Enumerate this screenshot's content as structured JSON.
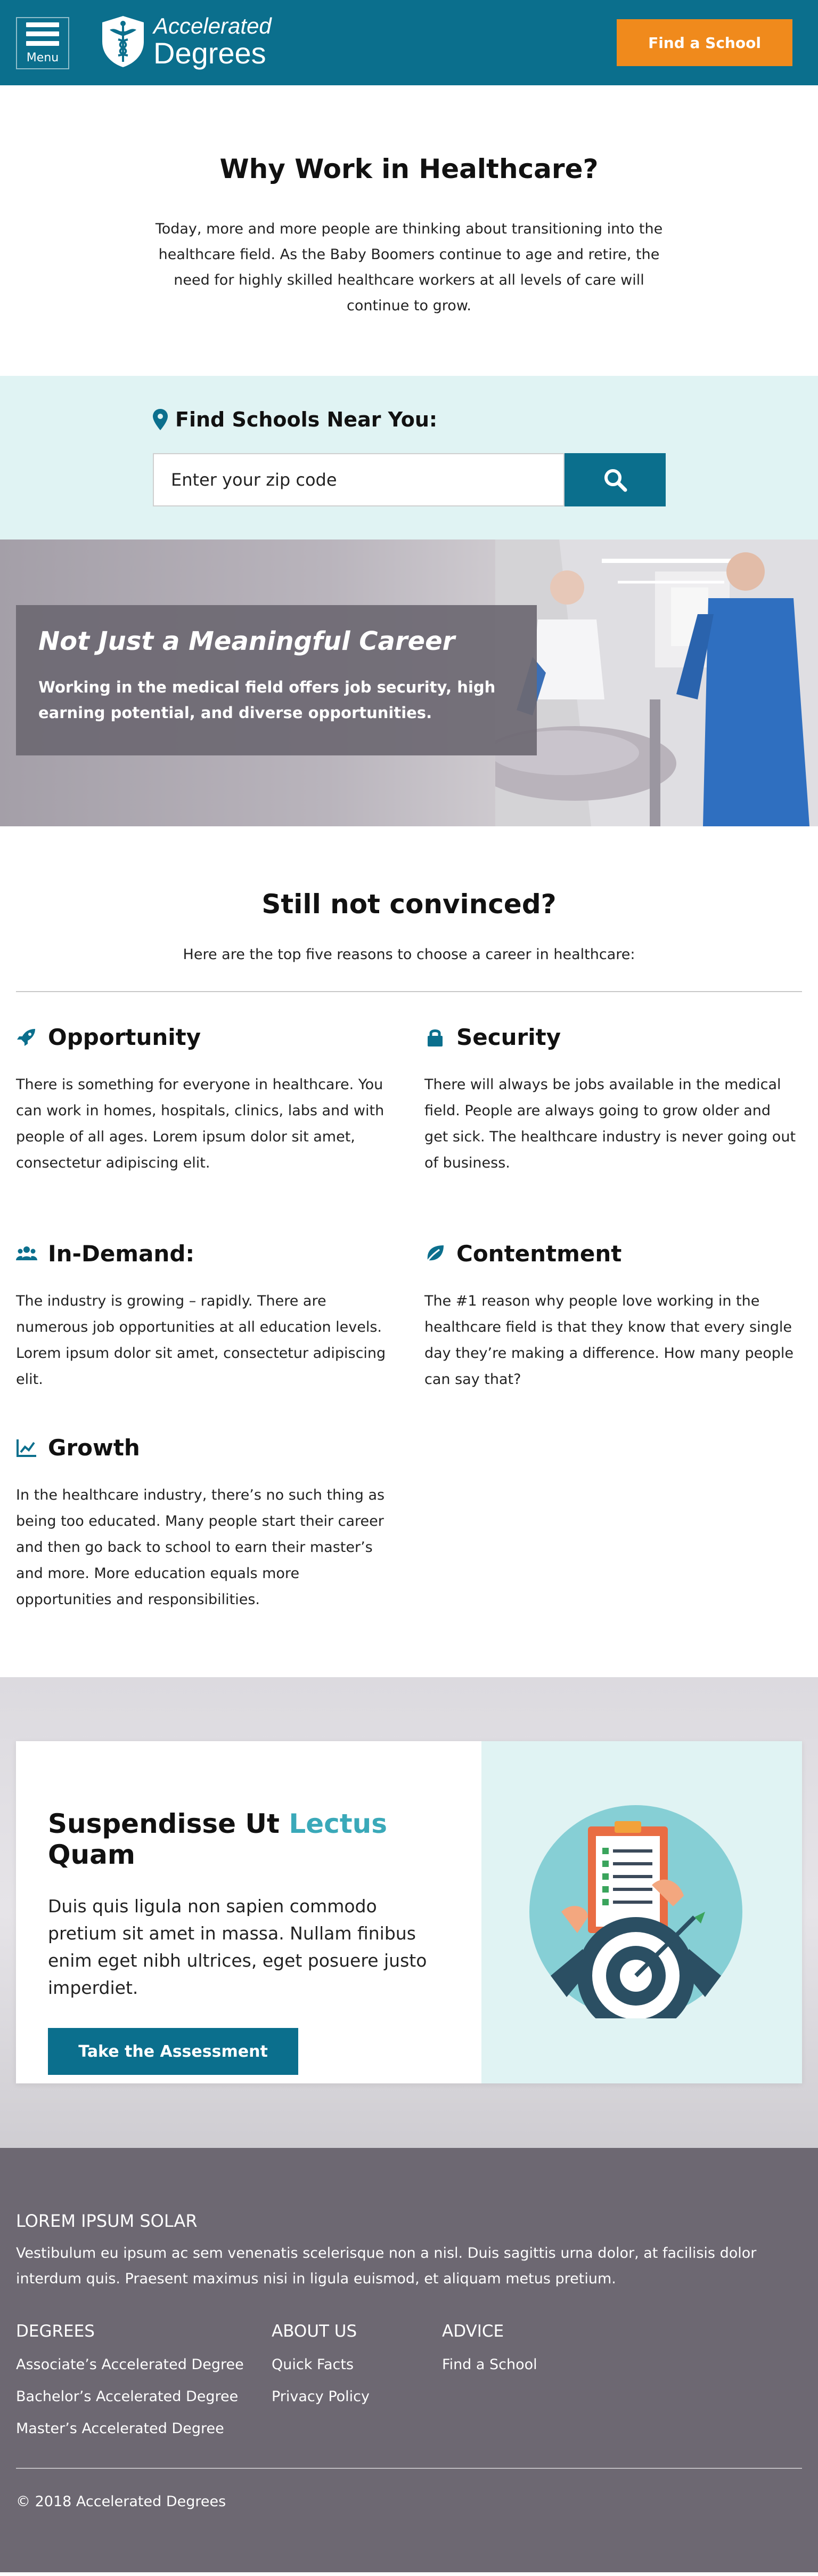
{
  "header": {
    "menu_label": "Menu",
    "logo_line1": "Accelerated",
    "logo_line2": "Degrees",
    "find_school_label": "Find a School",
    "colors": {
      "bar": "#0b6f8d",
      "cta": "#f08a1c"
    }
  },
  "why": {
    "title": "Why Work in Healthcare?",
    "text": "Today, more and more people are thinking about transitioning into the healthcare field. As the Baby Boomers continue to age and retire, the need for highly skilled healthcare workers at all levels of care will continue to grow."
  },
  "find": {
    "title": "Find Schools Near You:",
    "icon": "map-marker-icon",
    "zip_placeholder": "Enter your zip code",
    "search_icon": "search-icon"
  },
  "hero": {
    "title": "Not Just a Meaningful Career",
    "text": "Working in the medical field offers job security, high earning potential, and diverse opportunities."
  },
  "convinced": {
    "title": "Still not convinced?",
    "subtitle": "Here are the top five reasons to choose a career in healthcare:"
  },
  "reasons": [
    {
      "icon": "rocket-icon",
      "title": "Opportunity",
      "text": "There is something for everyone in healthcare. You can work in homes, hospitals, clinics, labs and with people of all ages. Lorem ipsum dolor sit amet, consectetur adipiscing elit."
    },
    {
      "icon": "lock-icon",
      "title": "Security",
      "text": "There will always be jobs available in the medical field. People are always going to grow older and get sick. The healthcare industry is never going out of business."
    },
    {
      "icon": "users-icon",
      "title": "In-Demand:",
      "text": "The industry is growing – rapidly. There are numerous job opportunities at all education levels. Lorem ipsum dolor sit amet, consectetur adipiscing elit."
    },
    {
      "icon": "leaf-icon",
      "title": "Contentment",
      "text": "The #1 reason why people love working in the healthcare field is that they know that every single day they’re making a difference. How many people can say that?"
    },
    {
      "icon": "chart-line-icon",
      "title": "Growth",
      "text": "In the healthcare industry, there’s no such thing as being too educated. Many people start their career and then go back to school to earn their master’s and more. More education equals more opportunities and responsibilities."
    }
  ],
  "cta": {
    "title_part1": "Suspendisse Ut ",
    "title_accent": "Lectus",
    "title_part2": " Quam",
    "text": "Duis quis ligula non sapien commodo pretium sit amet in massa. Nullam finibus enim eget nibh ultrices, eget posuere justo imperdiet.",
    "button_label": "Take the Assessment",
    "accent_color": "#3aa9b9"
  },
  "footer": {
    "heading": "LOREM IPSUM SOLAR",
    "text": "Vestibulum eu ipsum ac sem venenatis scelerisque non a nisl. Duis sagittis urna dolor, at facilisis dolor interdum quis. Praesent maximus nisi in ligula euismod, et aliquam metus pretium.",
    "columns": [
      {
        "heading": "DEGREES",
        "links": [
          "Associate’s Accelerated Degree",
          "Bachelor’s Accelerated Degree",
          "Master’s Accelerated Degree"
        ]
      },
      {
        "heading": "ABOUT US",
        "links": [
          "Quick Facts",
          "Privacy Policy"
        ]
      },
      {
        "heading": "ADVICE",
        "links": [
          "Find a School"
        ]
      }
    ],
    "copyright": "© 2018 Accelerated Degrees"
  }
}
